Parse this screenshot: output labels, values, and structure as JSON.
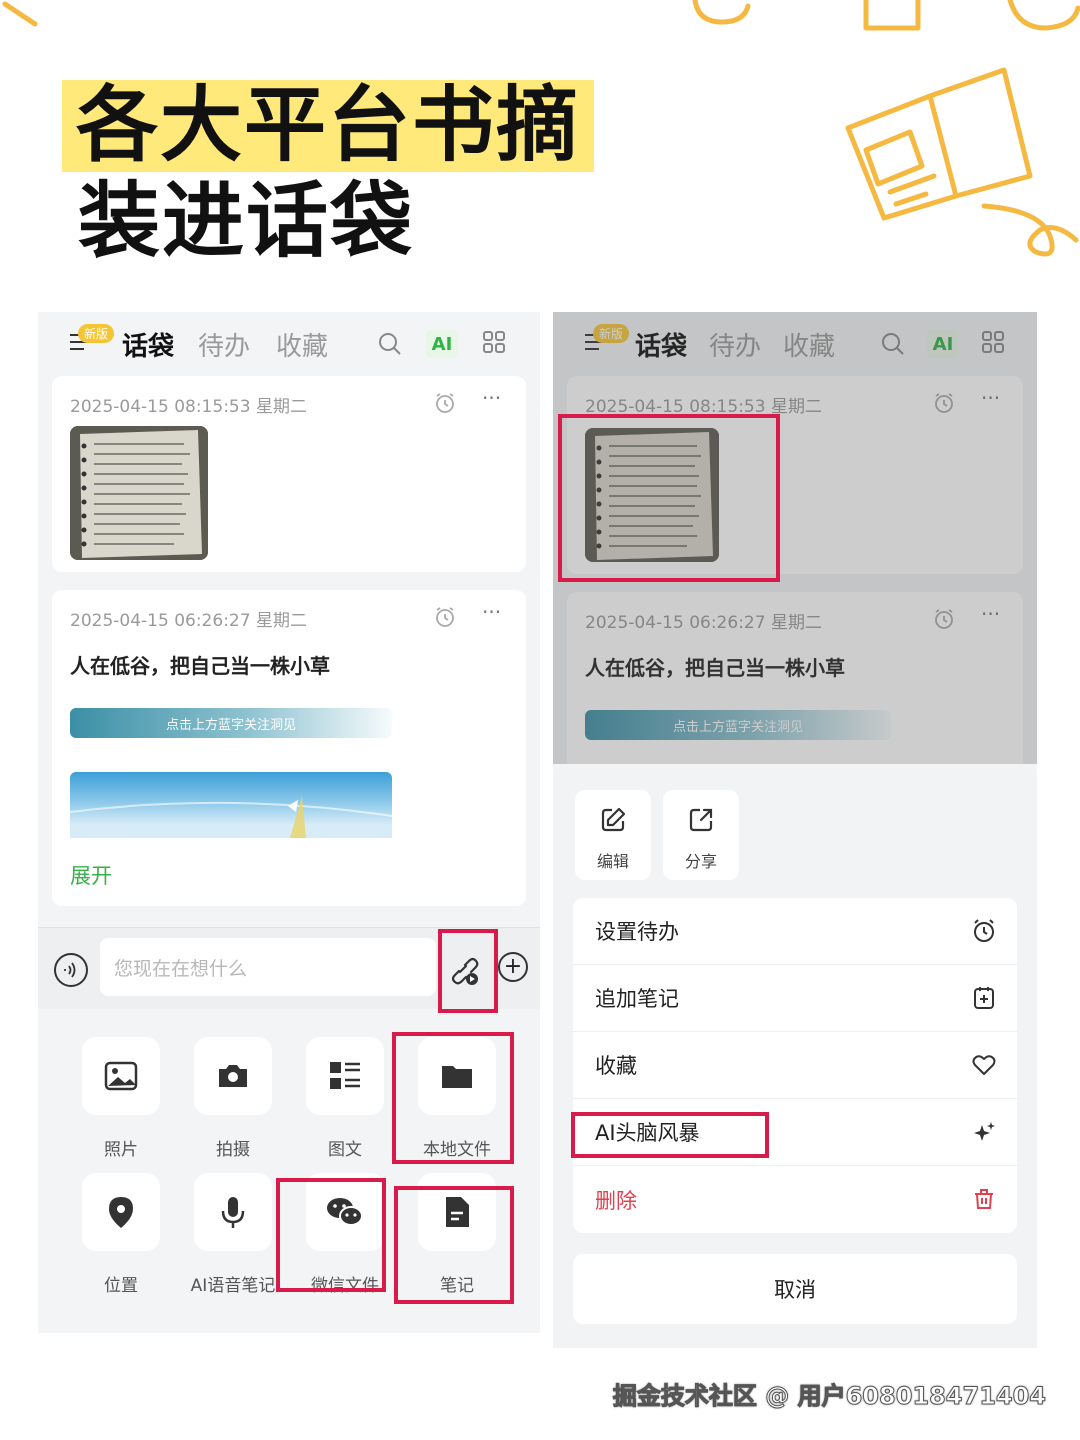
{
  "headline": {
    "line1": "各大平台书摘",
    "line2": "装进话袋"
  },
  "accent_colors": {
    "highlight": "#ffe97a",
    "annotation_red": "#d81b4a",
    "green": "#36b04a",
    "deco_orange": "#f5b942"
  },
  "left_panel": {
    "topbar": {
      "badge": "新版",
      "tabs": [
        "话袋",
        "待办",
        "收藏"
      ],
      "ai": "AI",
      "icons": [
        "search-icon",
        "grid-icon"
      ]
    },
    "cards": [
      {
        "timestamp": "2025-04-15 08:15:53 星期二",
        "type": "photo"
      },
      {
        "timestamp": "2025-04-15 06:26:27 星期二",
        "title": "人在低谷，把自己当一株小草",
        "banner_text": "点击上方蓝字关注洞见",
        "expand": "展开"
      }
    ],
    "input": {
      "placeholder": "您现在在想什么"
    },
    "attachments": [
      {
        "label": "照片",
        "icon": "photo-icon"
      },
      {
        "label": "拍摄",
        "icon": "camera-icon"
      },
      {
        "label": "图文",
        "icon": "list-icon"
      },
      {
        "label": "本地文件",
        "icon": "folder-icon"
      },
      {
        "label": "位置",
        "icon": "location-icon"
      },
      {
        "label": "AI语音笔记",
        "icon": "microphone-icon"
      },
      {
        "label": "微信文件",
        "icon": "wechat-icon"
      },
      {
        "label": "笔记",
        "icon": "note-icon"
      }
    ]
  },
  "right_panel": {
    "topbar": {
      "badge": "新版",
      "tabs": [
        "话袋",
        "待办",
        "收藏"
      ],
      "ai": "AI"
    },
    "cards": [
      {
        "timestamp": "2025-04-15 08:15:53 星期二"
      },
      {
        "timestamp": "2025-04-15 06:26:27 星期二",
        "title": "人在低谷，把自己当一株小草",
        "banner_text": "点击上方蓝字关注洞见"
      }
    ],
    "actions": [
      {
        "label": "编辑",
        "icon": "edit-icon"
      },
      {
        "label": "分享",
        "icon": "share-icon"
      }
    ],
    "menu": [
      {
        "label": "设置待办",
        "icon": "alarm-icon"
      },
      {
        "label": "追加笔记",
        "icon": "add-note-icon"
      },
      {
        "label": "收藏",
        "icon": "heart-icon"
      },
      {
        "label": "AI头脑风暴",
        "icon": "sparkle-icon"
      },
      {
        "label": "删除",
        "icon": "trash-icon"
      }
    ],
    "cancel": "取消"
  },
  "watermark": "掘金技术社区 @ 用户608018471404"
}
